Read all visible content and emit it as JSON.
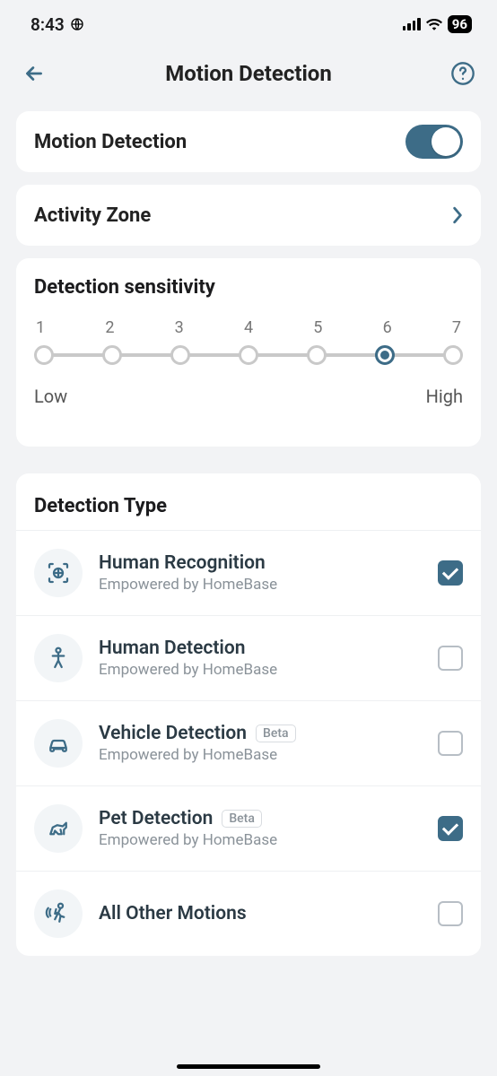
{
  "status": {
    "time": "8:43",
    "battery": "96"
  },
  "header": {
    "title": "Motion Detection"
  },
  "main_toggle": {
    "label": "Motion Detection",
    "on": true
  },
  "activity_zone": {
    "label": "Activity Zone"
  },
  "sensitivity": {
    "title": "Detection sensitivity",
    "ticks": [
      "1",
      "2",
      "3",
      "4",
      "5",
      "6",
      "7"
    ],
    "selected_index": 5,
    "low_label": "Low",
    "high_label": "High"
  },
  "detection_type": {
    "title": "Detection Type",
    "empowered": "Empowered by HomeBase",
    "beta": "Beta",
    "items": [
      {
        "name": "Human Recognition",
        "sub": true,
        "beta": false,
        "checked": true,
        "icon": "human-recognition"
      },
      {
        "name": "Human Detection",
        "sub": true,
        "beta": false,
        "checked": false,
        "icon": "human"
      },
      {
        "name": "Vehicle Detection",
        "sub": true,
        "beta": true,
        "checked": false,
        "icon": "vehicle"
      },
      {
        "name": "Pet Detection",
        "sub": true,
        "beta": true,
        "checked": true,
        "icon": "pet"
      },
      {
        "name": "All Other Motions",
        "sub": false,
        "beta": false,
        "checked": false,
        "icon": "motion"
      }
    ]
  }
}
